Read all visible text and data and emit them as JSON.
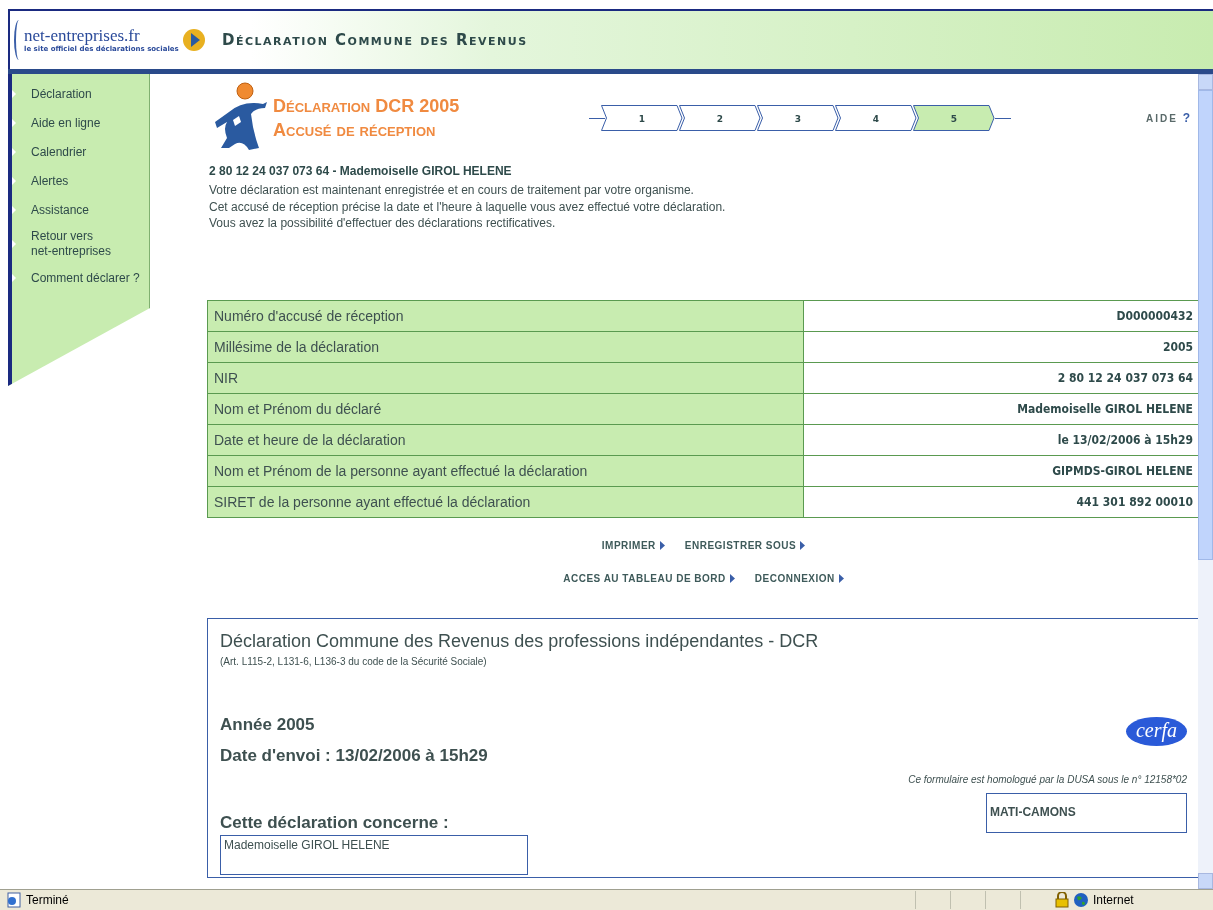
{
  "header": {
    "logo_name": "net-entreprises.fr",
    "logo_tagline": "le site officiel des déclarations sociales",
    "title": "Déclaration Commune des Revenus"
  },
  "sidebar": {
    "items": [
      {
        "label": "Déclaration"
      },
      {
        "label": "Aide en ligne"
      },
      {
        "label": "Calendrier"
      },
      {
        "label": "Alertes"
      },
      {
        "label": "Assistance"
      },
      {
        "label": "Retour vers\nnet-entreprises"
      },
      {
        "label": "Comment déclarer ?"
      }
    ]
  },
  "page_title": {
    "line_1": "Déclaration DCR 2005",
    "line_2": "Accusé de réception"
  },
  "steps": [
    {
      "label": "1",
      "selected": false
    },
    {
      "label": "2",
      "selected": false
    },
    {
      "label": "3",
      "selected": false
    },
    {
      "label": "4",
      "selected": false
    },
    {
      "label": "5",
      "selected": true
    }
  ],
  "help_link": {
    "label": "AIDE",
    "icon": "?"
  },
  "identity": "2 80 12 24 037 073 64 - Mademoiselle GIROL HELENE",
  "message": [
    "Votre déclaration est maintenant enregistrée et en cours de traitement par votre organisme.",
    "Cet accusé de réception précise la date et l'heure à laquelle vous avez effectué votre déclaration.",
    "Vous avez la possibilité d'effectuer des déclarations rectificatives."
  ],
  "receipt_table": [
    {
      "label": "Numéro d'accusé de réception",
      "value": "D000000432"
    },
    {
      "label": "Millésime de la déclaration",
      "value": "2005"
    },
    {
      "label": "NIR",
      "value": "2 80 12 24 037 073 64"
    },
    {
      "label": "Nom et Prénom du déclaré",
      "value": "Mademoiselle GIROL HELENE"
    },
    {
      "label": "Date et heure de la déclaration",
      "value": "le 13/02/2006 à 15h29"
    },
    {
      "label": "Nom et Prénom de la personne ayant effectué la déclaration",
      "value": "GIPMDS-GIROL HELENE"
    },
    {
      "label": "SIRET de la personne ayant effectué la déclaration",
      "value": "441 301 892 00010"
    }
  ],
  "action_links": [
    [
      "IMPRIMER",
      "ENREGISTRER SOUS"
    ],
    [
      "ACCES AU TABLEAU DE BORD",
      "DECONNEXION"
    ]
  ],
  "form": {
    "title": "Déclaration Commune des Revenus des professions indépendantes - DCR",
    "legal_ref": "(Art. L115-2, L131-6, L136-3 du code de la Sécurité Sociale)",
    "year": "Année 2005",
    "cerfa_logo": "cerfa",
    "sent_date": "Date d'envoi : 13/02/2006 à 15h29",
    "approval_note": "Ce formulaire est homologué par la DUSA sous le n° 12158*02",
    "concerns_heading": "Cette déclaration concerne :",
    "declarant_box": "Mademoiselle GIROL HELENE",
    "organism_box": "MATI-CAMONS"
  },
  "status_bar": {
    "status": "Terminé",
    "zone": "Internet"
  }
}
